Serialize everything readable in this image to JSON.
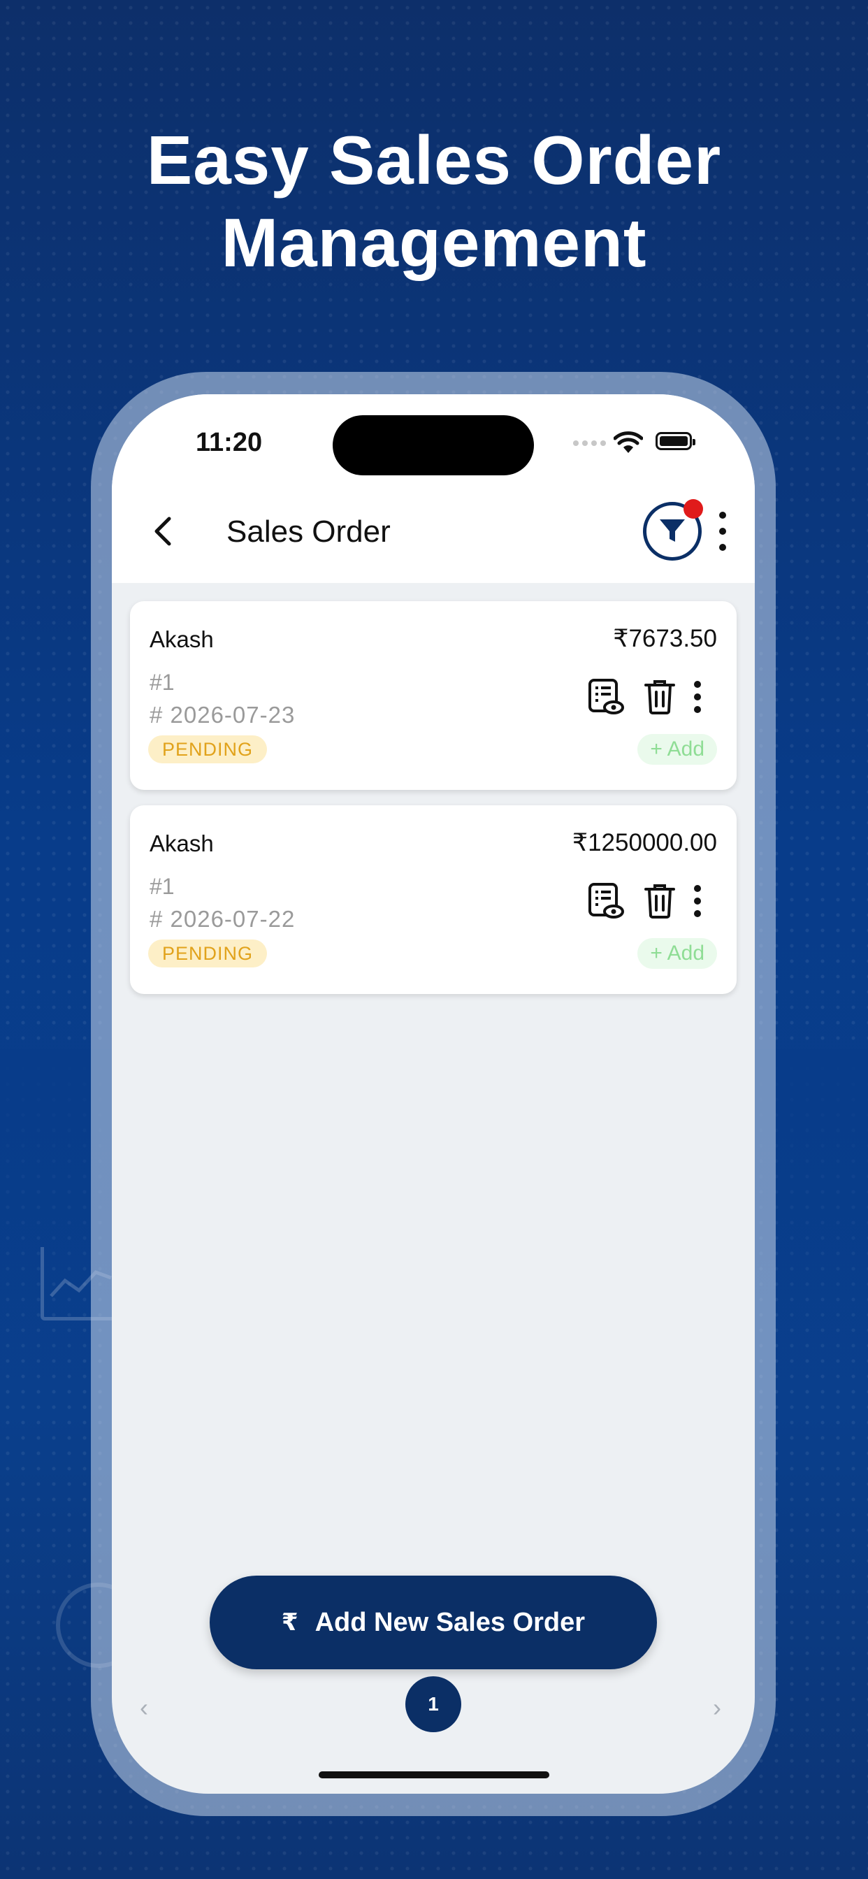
{
  "headline": {
    "line1": "Easy Sales Order",
    "line2": "Management"
  },
  "status_bar": {
    "time": "11:20"
  },
  "nav": {
    "title": "Sales Order",
    "back_icon": "chevron-left-icon",
    "filter_icon": "filter-icon",
    "filter_badge_color": "#e01b1b",
    "more_icon": "more-vertical-icon"
  },
  "orders": [
    {
      "customer": "Akash",
      "amount": "₹7673.50",
      "order_no": "#1",
      "date": "# 2026-07-23",
      "status": "PENDING",
      "add_label": "+ Add"
    },
    {
      "customer": "Akash",
      "amount": "₹1250000.00",
      "order_no": "#1",
      "date": "# 2026-07-22",
      "status": "PENDING",
      "add_label": "+ Add"
    }
  ],
  "fab": {
    "icon": "₹",
    "label": "Add New Sales Order"
  },
  "pagination": {
    "prev": "‹",
    "current": "1",
    "next": "›"
  },
  "colors": {
    "primary": "#0b2f66",
    "pending_bg": "#fdefc7",
    "pending_text": "#e1a21b",
    "add_bg": "#eafaec",
    "add_text": "#8fdd95",
    "background": "#0a3a84"
  }
}
